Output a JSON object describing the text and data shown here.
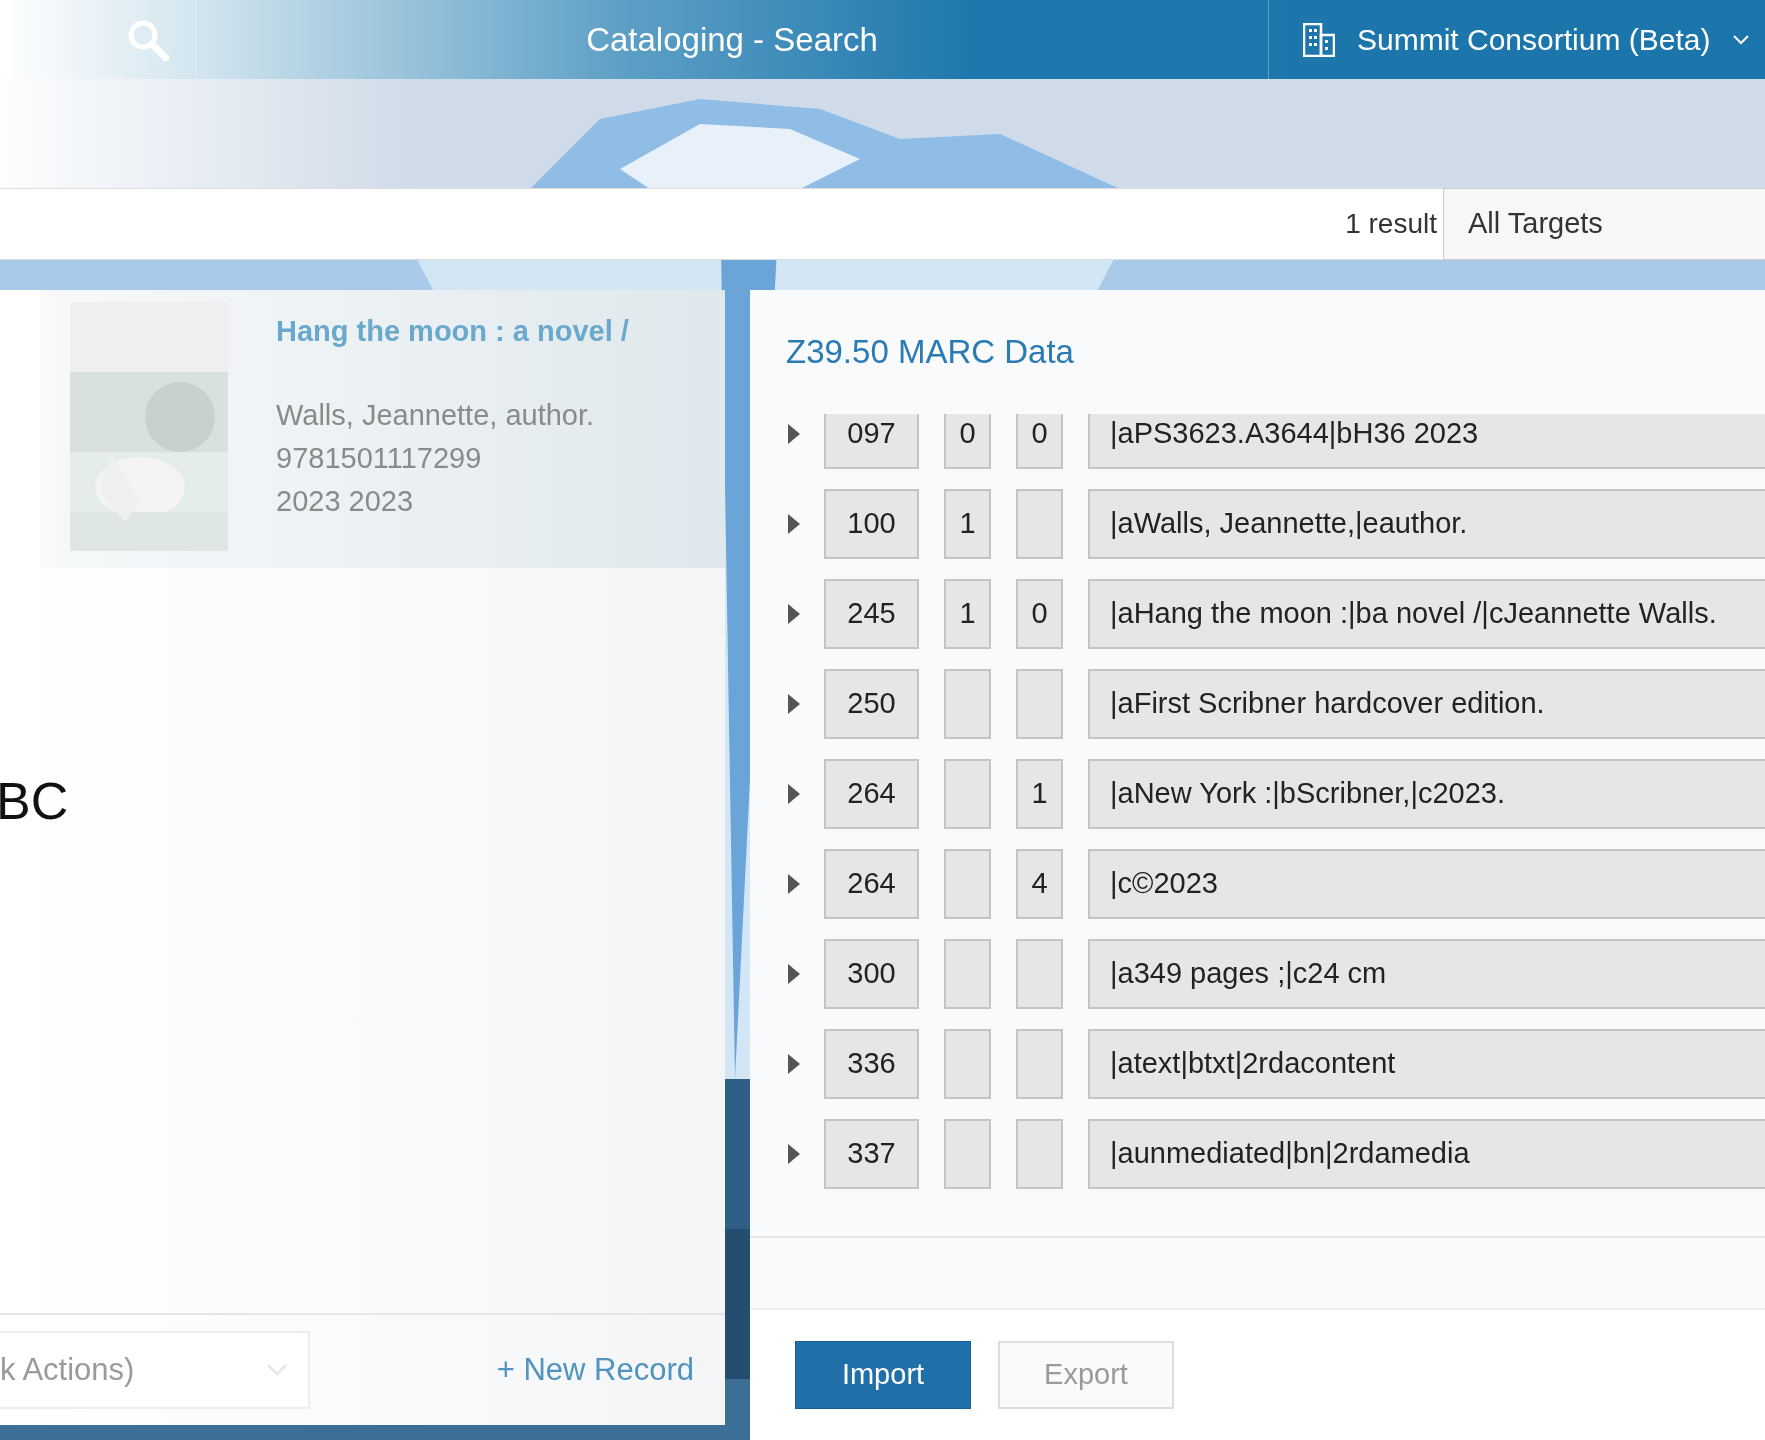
{
  "header": {
    "title": "Cataloging - Search",
    "library": "Summit Consortium (Beta)"
  },
  "search_bar": {
    "result_count": "1 result",
    "target": "All Targets"
  },
  "results": [
    {
      "title": "Hang the moon : a novel /",
      "author": "Walls, Jeannette, author.",
      "isbn": "9781501117299",
      "date": "2023 2023"
    }
  ],
  "side_text": "BC",
  "bulk_actions": {
    "value": "k Actions)"
  },
  "new_record": "+ New Record",
  "marc_panel": {
    "title": "Z39.50 MARC Data",
    "fields": [
      {
        "tag": "097",
        "ind1": "0",
        "ind2": "0",
        "data": "|aPS3623.A3644|bH36 2023"
      },
      {
        "tag": "100",
        "ind1": "1",
        "data": "|aWalls, Jeannette,|eauthor."
      },
      {
        "tag": "245",
        "ind1": "1",
        "ind2": "0",
        "data": "|aHang the moon :|ba novel /|cJeannette Walls."
      },
      {
        "tag": "250",
        "data": "|aFirst Scribner hardcover edition."
      },
      {
        "tag": "264",
        "ind2": "1",
        "data": "|aNew York :|bScribner,|c2023."
      },
      {
        "tag": "264",
        "ind2": "4",
        "data": "|c©2023"
      },
      {
        "tag": "300",
        "data": "|a349 pages ;|c24 cm"
      },
      {
        "tag": "336",
        "data": "|atext|btxt|2rdacontent"
      },
      {
        "tag": "337",
        "data": "|aunmediated|bn|2rdamedia"
      }
    ]
  },
  "buttons": [
    {
      "label": "Import",
      "kind": "primary",
      "disabled": false
    },
    {
      "label": "Export",
      "kind": "secondary",
      "disabled": true
    }
  ]
}
